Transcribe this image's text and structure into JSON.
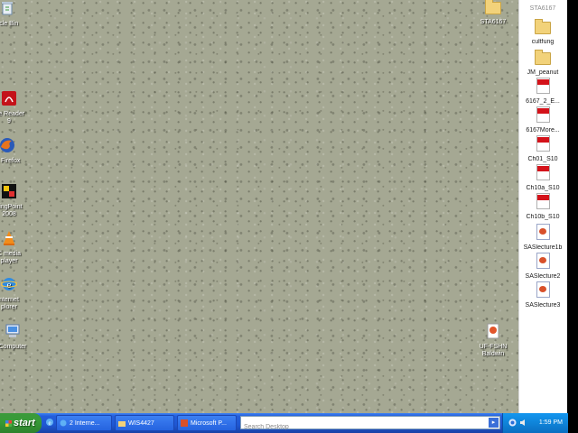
{
  "desktop": {
    "left_icons": [
      {
        "label": "ycle Bin",
        "icon": "recycle-bin-icon"
      },
      {
        "label": "ble Reader",
        "label2": "9",
        "icon": "adobe-reader-icon"
      },
      {
        "label": "la Firefox",
        "icon": "firefox-icon"
      },
      {
        "label": "ningPoint",
        "label2": "2008",
        "icon": "learningpoint-icon"
      },
      {
        "label": "C media",
        "label2": "player",
        "icon": "vlc-icon"
      },
      {
        "label": "nternet",
        "label2": "plorer",
        "icon": "internet-explorer-icon"
      },
      {
        "label": "Computer",
        "icon": "my-computer-icon"
      }
    ],
    "right_icons": [
      {
        "label": "STA6167",
        "icon": "folder-icon"
      },
      {
        "label": "UF-FSHN",
        "label2": "Baldwin",
        "icon": "document-icon"
      }
    ]
  },
  "side_panel": {
    "header": "STA6167",
    "items": [
      {
        "label": "cultfung",
        "icon": "folder-icon"
      },
      {
        "label": "JM_peanut",
        "icon": "folder-icon"
      },
      {
        "label": "6167_2_E...",
        "icon": "pdf-icon"
      },
      {
        "label": "6167More...",
        "icon": "pdf-icon"
      },
      {
        "label": "Ch01_S10",
        "icon": "pdf-icon"
      },
      {
        "label": "Ch10a_S10",
        "icon": "pdf-icon"
      },
      {
        "label": "Ch10b_S10",
        "icon": "pdf-icon"
      },
      {
        "label": "SASlecture1b",
        "icon": "ppt-icon"
      },
      {
        "label": "SASlecture2",
        "icon": "ppt-icon"
      },
      {
        "label": "SASlecture3",
        "icon": "ppt-icon"
      }
    ]
  },
  "taskbar": {
    "start_label": "start",
    "tasks": [
      {
        "label": "2 Interne...",
        "icon": "internet-explorer-icon"
      },
      {
        "label": "WIS4427",
        "icon": "folder-icon"
      },
      {
        "label": "Microsoft P...",
        "icon": "powerpoint-icon"
      }
    ],
    "search": {
      "placeholder": "Search Desktop"
    },
    "clock": "1:59 PM"
  },
  "colors": {
    "desktop_bg": "#a5a893",
    "taskbar": "#245edb",
    "start": "#379b37",
    "tray": "#0f84d9"
  }
}
